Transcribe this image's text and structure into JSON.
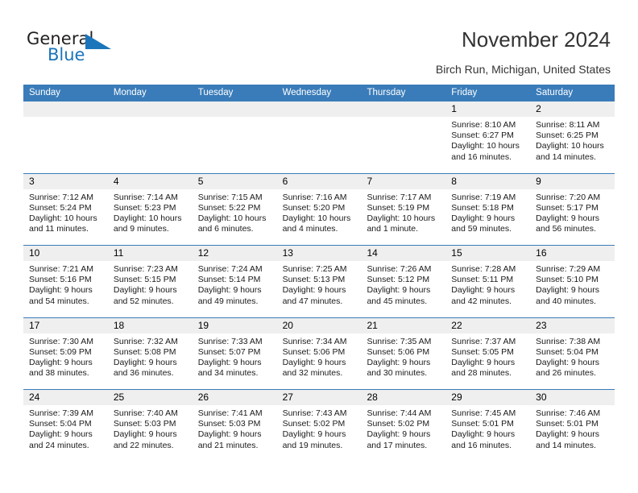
{
  "brand": {
    "name_part1": "General",
    "name_part2": "Blue"
  },
  "header": {
    "title": "November 2024",
    "subtitle": "Birch Run, Michigan, United States"
  },
  "calendar": {
    "weekdays": [
      "Sunday",
      "Monday",
      "Tuesday",
      "Wednesday",
      "Thursday",
      "Friday",
      "Saturday"
    ],
    "labels": {
      "sunrise": "Sunrise:",
      "sunset": "Sunset:",
      "daylight": "Daylight:"
    },
    "colors": {
      "header_blue": "#3a7cb9",
      "band_gray": "#efefef",
      "brand_blue": "#1b75bb",
      "text": "#1a1a1a"
    },
    "weeks": [
      [
        {
          "day": "",
          "empty": true
        },
        {
          "day": "",
          "empty": true
        },
        {
          "day": "",
          "empty": true
        },
        {
          "day": "",
          "empty": true
        },
        {
          "day": "",
          "empty": true
        },
        {
          "day": "1",
          "sunrise": "Sunrise: 8:10 AM",
          "sunset": "Sunset: 6:27 PM",
          "daylight": "Daylight: 10 hours and 16 minutes."
        },
        {
          "day": "2",
          "sunrise": "Sunrise: 8:11 AM",
          "sunset": "Sunset: 6:25 PM",
          "daylight": "Daylight: 10 hours and 14 minutes."
        }
      ],
      [
        {
          "day": "3",
          "sunrise": "Sunrise: 7:12 AM",
          "sunset": "Sunset: 5:24 PM",
          "daylight": "Daylight: 10 hours and 11 minutes."
        },
        {
          "day": "4",
          "sunrise": "Sunrise: 7:14 AM",
          "sunset": "Sunset: 5:23 PM",
          "daylight": "Daylight: 10 hours and 9 minutes."
        },
        {
          "day": "5",
          "sunrise": "Sunrise: 7:15 AM",
          "sunset": "Sunset: 5:22 PM",
          "daylight": "Daylight: 10 hours and 6 minutes."
        },
        {
          "day": "6",
          "sunrise": "Sunrise: 7:16 AM",
          "sunset": "Sunset: 5:20 PM",
          "daylight": "Daylight: 10 hours and 4 minutes."
        },
        {
          "day": "7",
          "sunrise": "Sunrise: 7:17 AM",
          "sunset": "Sunset: 5:19 PM",
          "daylight": "Daylight: 10 hours and 1 minute."
        },
        {
          "day": "8",
          "sunrise": "Sunrise: 7:19 AM",
          "sunset": "Sunset: 5:18 PM",
          "daylight": "Daylight: 9 hours and 59 minutes."
        },
        {
          "day": "9",
          "sunrise": "Sunrise: 7:20 AM",
          "sunset": "Sunset: 5:17 PM",
          "daylight": "Daylight: 9 hours and 56 minutes."
        }
      ],
      [
        {
          "day": "10",
          "sunrise": "Sunrise: 7:21 AM",
          "sunset": "Sunset: 5:16 PM",
          "daylight": "Daylight: 9 hours and 54 minutes."
        },
        {
          "day": "11",
          "sunrise": "Sunrise: 7:23 AM",
          "sunset": "Sunset: 5:15 PM",
          "daylight": "Daylight: 9 hours and 52 minutes."
        },
        {
          "day": "12",
          "sunrise": "Sunrise: 7:24 AM",
          "sunset": "Sunset: 5:14 PM",
          "daylight": "Daylight: 9 hours and 49 minutes."
        },
        {
          "day": "13",
          "sunrise": "Sunrise: 7:25 AM",
          "sunset": "Sunset: 5:13 PM",
          "daylight": "Daylight: 9 hours and 47 minutes."
        },
        {
          "day": "14",
          "sunrise": "Sunrise: 7:26 AM",
          "sunset": "Sunset: 5:12 PM",
          "daylight": "Daylight: 9 hours and 45 minutes."
        },
        {
          "day": "15",
          "sunrise": "Sunrise: 7:28 AM",
          "sunset": "Sunset: 5:11 PM",
          "daylight": "Daylight: 9 hours and 42 minutes."
        },
        {
          "day": "16",
          "sunrise": "Sunrise: 7:29 AM",
          "sunset": "Sunset: 5:10 PM",
          "daylight": "Daylight: 9 hours and 40 minutes."
        }
      ],
      [
        {
          "day": "17",
          "sunrise": "Sunrise: 7:30 AM",
          "sunset": "Sunset: 5:09 PM",
          "daylight": "Daylight: 9 hours and 38 minutes."
        },
        {
          "day": "18",
          "sunrise": "Sunrise: 7:32 AM",
          "sunset": "Sunset: 5:08 PM",
          "daylight": "Daylight: 9 hours and 36 minutes."
        },
        {
          "day": "19",
          "sunrise": "Sunrise: 7:33 AM",
          "sunset": "Sunset: 5:07 PM",
          "daylight": "Daylight: 9 hours and 34 minutes."
        },
        {
          "day": "20",
          "sunrise": "Sunrise: 7:34 AM",
          "sunset": "Sunset: 5:06 PM",
          "daylight": "Daylight: 9 hours and 32 minutes."
        },
        {
          "day": "21",
          "sunrise": "Sunrise: 7:35 AM",
          "sunset": "Sunset: 5:06 PM",
          "daylight": "Daylight: 9 hours and 30 minutes."
        },
        {
          "day": "22",
          "sunrise": "Sunrise: 7:37 AM",
          "sunset": "Sunset: 5:05 PM",
          "daylight": "Daylight: 9 hours and 28 minutes."
        },
        {
          "day": "23",
          "sunrise": "Sunrise: 7:38 AM",
          "sunset": "Sunset: 5:04 PM",
          "daylight": "Daylight: 9 hours and 26 minutes."
        }
      ],
      [
        {
          "day": "24",
          "sunrise": "Sunrise: 7:39 AM",
          "sunset": "Sunset: 5:04 PM",
          "daylight": "Daylight: 9 hours and 24 minutes."
        },
        {
          "day": "25",
          "sunrise": "Sunrise: 7:40 AM",
          "sunset": "Sunset: 5:03 PM",
          "daylight": "Daylight: 9 hours and 22 minutes."
        },
        {
          "day": "26",
          "sunrise": "Sunrise: 7:41 AM",
          "sunset": "Sunset: 5:03 PM",
          "daylight": "Daylight: 9 hours and 21 minutes."
        },
        {
          "day": "27",
          "sunrise": "Sunrise: 7:43 AM",
          "sunset": "Sunset: 5:02 PM",
          "daylight": "Daylight: 9 hours and 19 minutes."
        },
        {
          "day": "28",
          "sunrise": "Sunrise: 7:44 AM",
          "sunset": "Sunset: 5:02 PM",
          "daylight": "Daylight: 9 hours and 17 minutes."
        },
        {
          "day": "29",
          "sunrise": "Sunrise: 7:45 AM",
          "sunset": "Sunset: 5:01 PM",
          "daylight": "Daylight: 9 hours and 16 minutes."
        },
        {
          "day": "30",
          "sunrise": "Sunrise: 7:46 AM",
          "sunset": "Sunset: 5:01 PM",
          "daylight": "Daylight: 9 hours and 14 minutes."
        }
      ]
    ]
  }
}
